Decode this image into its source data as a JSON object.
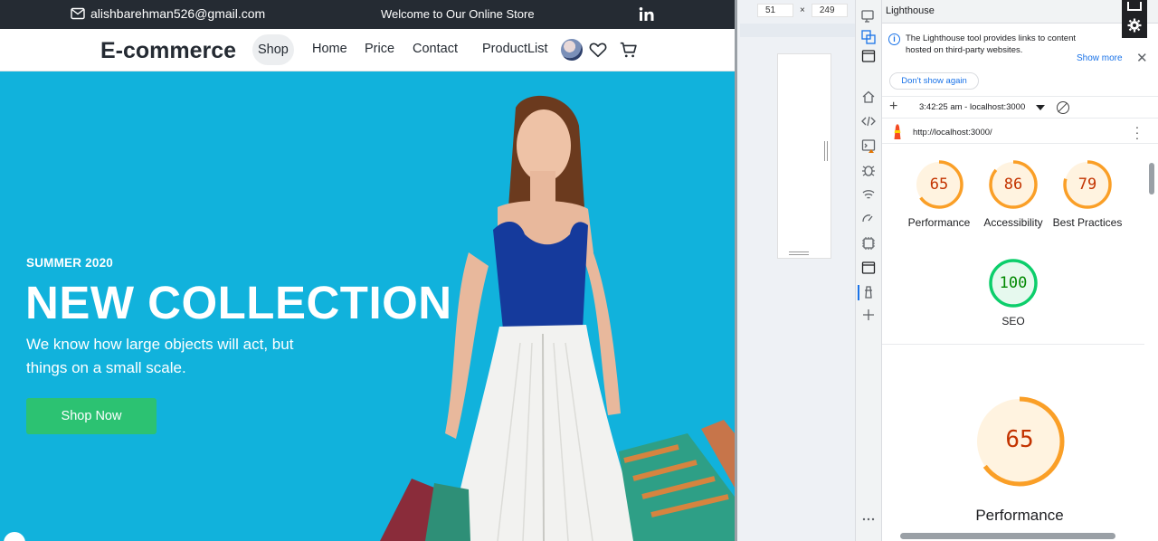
{
  "site": {
    "topbar": {
      "email": "alishbarehman526@gmail.com",
      "welcome": "Welcome to Our Online Store",
      "email_icon": "mail-icon",
      "social_icon": "linkedin-icon"
    },
    "nav": {
      "brand": "E-commerce",
      "links": [
        "Shop",
        "Home",
        "Price",
        "Contact",
        "ProductList"
      ],
      "icons": [
        "avatar",
        "heart-icon",
        "cart-icon"
      ]
    },
    "hero": {
      "pre_title": "SUMMER 2020",
      "title": "NEW COLLECTION",
      "subtitle": "We know how large objects will act, but things on a small scale.",
      "cta": "Shop Now",
      "background_color": "#11b2dc",
      "cta_color": "#2cc272"
    }
  },
  "device_toolbar": {
    "width": "51",
    "separator": "×",
    "height": "249"
  },
  "devtools": {
    "panel_title": "Lighthouse",
    "info_banner": {
      "text": "The Lighthouse tool provides links to content hosted on third-party websites.",
      "show_more": "Show more",
      "dismiss": "Don't show again"
    },
    "session": {
      "label": "3:42:25 am - localhost:3000",
      "url": "http://localhost:3000/"
    },
    "scores": [
      {
        "label": "Performance",
        "value": 65,
        "color": "#fa9f27"
      },
      {
        "label": "Accessibility",
        "value": 86,
        "color": "#fa9f27"
      },
      {
        "label": "Best Practices",
        "value": 79,
        "color": "#fa9f27"
      },
      {
        "label": "SEO",
        "value": 100,
        "color": "#0cce6b"
      }
    ],
    "detail": {
      "label": "Performance",
      "value": 65
    },
    "side_icons": [
      "device-icon",
      "inspect-icon",
      "elements-icon",
      "home-icon",
      "sources-icon",
      "console-icon",
      "bug-icon",
      "network-icon",
      "performance-icon",
      "memory-icon",
      "application-icon",
      "lighthouse-icon",
      "add-icon",
      "more-icon"
    ]
  }
}
